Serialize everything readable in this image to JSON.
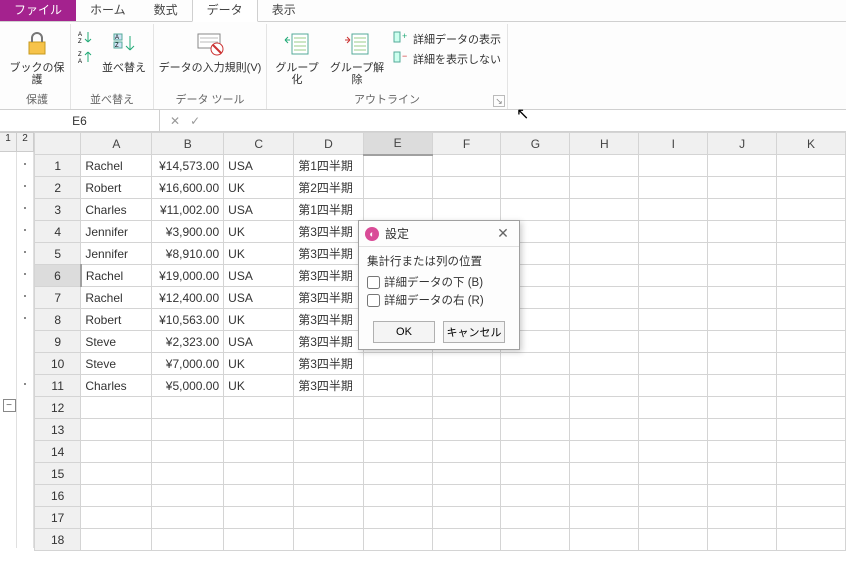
{
  "tabs": {
    "file": "ファイル",
    "home": "ホーム",
    "formula": "数式",
    "data": "データ",
    "view": "表示"
  },
  "ribbon": {
    "protect": {
      "label": "ブックの保護",
      "group": "保護"
    },
    "sort": {
      "asc": "A→Z",
      "desc": "Z→A",
      "btn": "並べ替え",
      "group": "並べ替え"
    },
    "validation": {
      "label": "データの入力規則(V)",
      "group": "データ ツール"
    },
    "group": {
      "label": "グループ化"
    },
    "ungroup": {
      "label": "グループ解除"
    },
    "showdetail": "詳細データの表示",
    "hidedetail": "詳細を表示しない",
    "outline_group": "アウトライン"
  },
  "namebox": "E6",
  "cols": [
    "A",
    "B",
    "C",
    "D",
    "E",
    "F",
    "G",
    "H",
    "I",
    "J",
    "K"
  ],
  "outline_levels": [
    "1",
    "2"
  ],
  "outline_collapse": "−",
  "rows": [
    {
      "n": 1,
      "a": "Rachel",
      "b": "¥14,573.00",
      "c": "USA",
      "d": "第1四半期",
      "dot": true
    },
    {
      "n": 2,
      "a": "Robert",
      "b": "¥16,600.00",
      "c": "UK",
      "d": "第2四半期",
      "dot": true
    },
    {
      "n": 3,
      "a": "Charles",
      "b": "¥11,002.00",
      "c": "USA",
      "d": "第1四半期",
      "dot": true
    },
    {
      "n": 4,
      "a": "Jennifer",
      "b": "¥3,900.00",
      "c": "UK",
      "d": "第3四半期",
      "dot": true
    },
    {
      "n": 5,
      "a": "Jennifer",
      "b": "¥8,910.00",
      "c": "UK",
      "d": "第3四半期",
      "dot": true
    },
    {
      "n": 6,
      "a": "Rachel",
      "b": "¥19,000.00",
      "c": "USA",
      "d": "第3四半期",
      "dot": true,
      "sel": true
    },
    {
      "n": 7,
      "a": "Rachel",
      "b": "¥12,400.00",
      "c": "USA",
      "d": "第3四半期",
      "dot": true
    },
    {
      "n": 8,
      "a": "Robert",
      "b": "¥10,563.00",
      "c": "UK",
      "d": "第3四半期",
      "dot": true
    },
    {
      "n": 9,
      "a": "Steve",
      "b": "¥2,323.00",
      "c": "USA",
      "d": "第3四半期"
    },
    {
      "n": 10,
      "a": "Steve",
      "b": "¥7,000.00",
      "c": "UK",
      "d": "第3四半期"
    },
    {
      "n": 11,
      "a": "Charles",
      "b": "¥5,000.00",
      "c": "UK",
      "d": "第3四半期",
      "dot": true
    },
    {
      "n": 12
    },
    {
      "n": 13
    },
    {
      "n": 14
    },
    {
      "n": 15
    },
    {
      "n": 16
    },
    {
      "n": 17
    },
    {
      "n": 18
    }
  ],
  "dialog": {
    "title": "設定",
    "section": "集計行または列の位置",
    "opt1": "詳細データの下 (B)",
    "opt2": "詳細データの右 (R)",
    "ok": "OK",
    "cancel": "キャンセル"
  }
}
